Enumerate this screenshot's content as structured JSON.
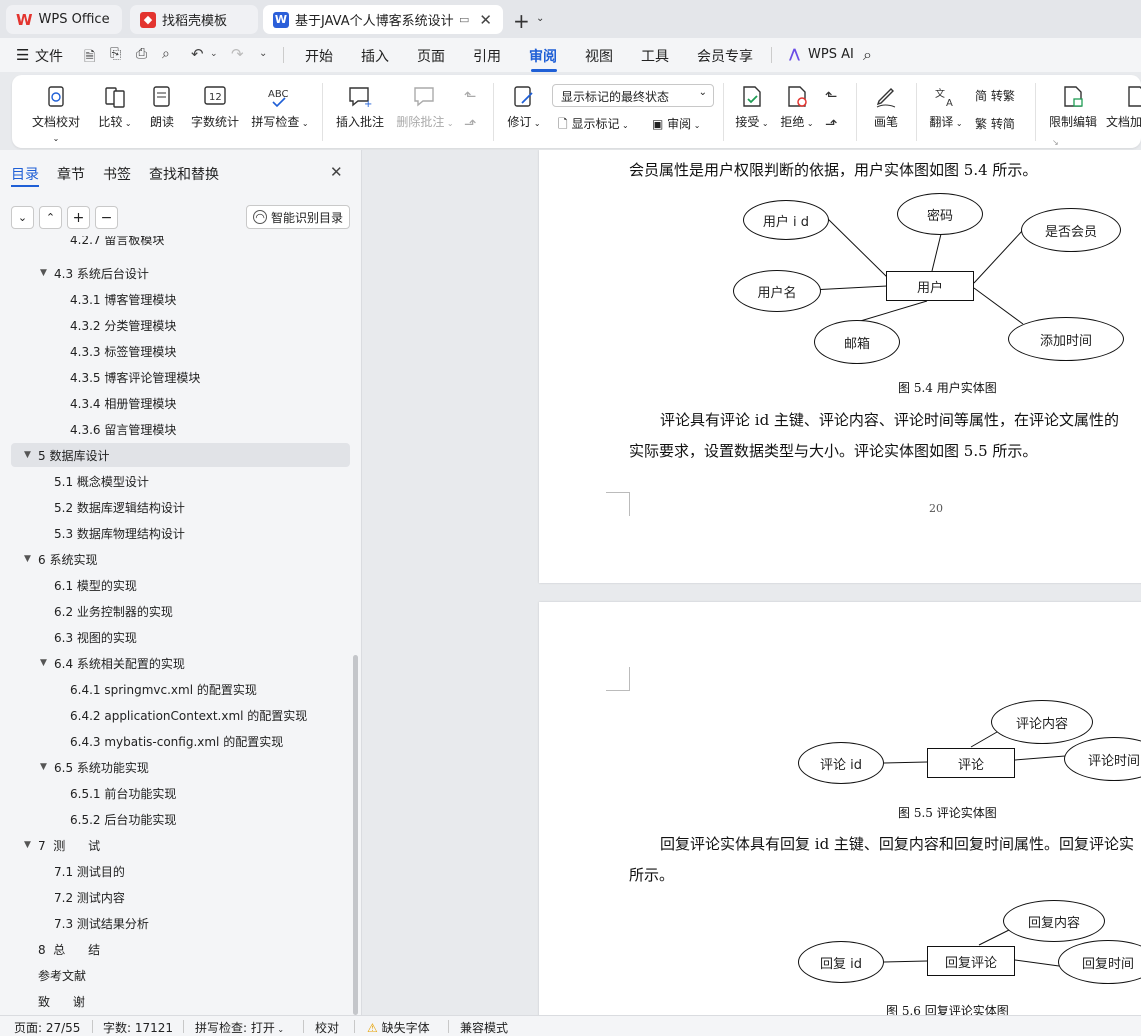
{
  "tabs": [
    {
      "label": "WPS Office",
      "icon": "wps-logo-icon"
    },
    {
      "label": "找稻壳模板",
      "icon": "docer-icon"
    },
    {
      "label": "基于JAVA个人博客系统设计 与",
      "icon": "word-doc-icon",
      "active": true
    }
  ],
  "menu": {
    "file": "文件",
    "items": [
      "开始",
      "插入",
      "页面",
      "引用",
      "审阅",
      "视图",
      "工具",
      "会员专享"
    ],
    "active": "审阅",
    "wps_ai": "WPS AI"
  },
  "ribbon": {
    "doc_check": "文档校对",
    "compare": "比较",
    "read_aloud": "朗读",
    "word_count": "字数统计",
    "spell_check": "拼写检查",
    "insert_comment": "插入批注",
    "delete_comment": "删除批注",
    "revise": "修订",
    "markup_state": "显示标记的最终状态",
    "show_markup": "显示标记",
    "review": "审阅",
    "accept": "接受",
    "reject": "拒绝",
    "pen": "画笔",
    "translate": "翻译",
    "to_traditional": "转繁",
    "to_simplified": "转简",
    "restrict_edit": "限制编辑",
    "doc_encrypt": "文档加"
  },
  "sidebar": {
    "tabs": [
      "目录",
      "章节",
      "书签",
      "查找和替换"
    ],
    "smart_toc": "智能识别目录",
    "toc": [
      {
        "label": "4.2.7  留言板模块",
        "level": 3
      },
      {
        "label": "4.3  系统后台设计",
        "level": 2,
        "expanded": true
      },
      {
        "label": "4.3.1  博客管理模块",
        "level": 3
      },
      {
        "label": "4.3.2  分类管理模块",
        "level": 3
      },
      {
        "label": "4.3.3  标签管理模块",
        "level": 3
      },
      {
        "label": "4.3.5  博客评论管理模块",
        "level": 3
      },
      {
        "label": "4.3.4  相册管理模块",
        "level": 3
      },
      {
        "label": "4.3.6  留言管理模块",
        "level": 3
      },
      {
        "label": "5  数据库设计",
        "level": 1,
        "expanded": true,
        "selected": true
      },
      {
        "label": "5.1  概念模型设计",
        "level": 2
      },
      {
        "label": "5.2  数据库逻辑结构设计",
        "level": 2
      },
      {
        "label": "5.3  数据库物理结构设计",
        "level": 2
      },
      {
        "label": "6  系统实现",
        "level": 1,
        "expanded": true
      },
      {
        "label": "6.1  模型的实现",
        "level": 2
      },
      {
        "label": "6.2  业务控制器的实现",
        "level": 2
      },
      {
        "label": "6.3  视图的实现",
        "level": 2
      },
      {
        "label": "6.4  系统相关配置的实现",
        "level": 2,
        "expanded": true
      },
      {
        "label": "6.4.1 springmvc.xml 的配置实现",
        "level": 3
      },
      {
        "label": "6.4.2 applicationContext.xml 的配置实现",
        "level": 3
      },
      {
        "label": "6.4.3 mybatis-config.xml 的配置实现",
        "level": 3
      },
      {
        "label": "6.5  系统功能实现",
        "level": 2,
        "expanded": true
      },
      {
        "label": "6.5.1  前台功能实现",
        "level": 3
      },
      {
        "label": "6.5.2  后台功能实现",
        "level": 3
      },
      {
        "label": "7  测      试",
        "level": 1,
        "expanded": true
      },
      {
        "label": "7.1  测试目的",
        "level": 2
      },
      {
        "label": "7.2  测试内容",
        "level": 2
      },
      {
        "label": "7.3  测试结果分析",
        "level": 2
      },
      {
        "label": "8  总      结",
        "level": 1
      },
      {
        "label": "参考文献",
        "level": 1
      },
      {
        "label": "致      谢",
        "level": 1
      }
    ]
  },
  "document": {
    "page1": {
      "line1": "会员属性是用户权限判断的依据，用户实体图如图 5.4 所示。",
      "fig54": {
        "entity": "用户",
        "attrs": [
          "用户 i d",
          "密码",
          "是否会员",
          "用户名",
          "邮箱",
          "添加时间"
        ],
        "caption": "图 5.4  用户实体图"
      },
      "para2_line1": "评论具有评论 id 主键、评论内容、评论时间等属性，在评论文属性的",
      "para2_line2": "实际要求，设置数据类型与大小。评论实体图如图 5.5 所示。",
      "page_number": "20"
    },
    "page2": {
      "fig55": {
        "entity": "评论",
        "attrs": [
          "评论 id",
          "评论内容",
          "评论时间"
        ],
        "caption": "图 5.5  评论实体图"
      },
      "para3_line1": "回复评论实体具有回复 id 主键、回复内容和回复时间属性。回复评论实",
      "para3_line2": "所示。",
      "fig56": {
        "entity": "回复评论",
        "attrs": [
          "回复 id",
          "回复内容",
          "回复时间"
        ],
        "caption": "图 5.6  回复评论实体图"
      }
    }
  },
  "status": {
    "page": "页面: 27/55",
    "words": "字数: 17121",
    "spell": "拼写检查: 打开",
    "proof": "校对",
    "missing_font": "缺失字体",
    "compat": "兼容模式"
  },
  "colors": {
    "accent": "#1f5fd6",
    "wps_red": "#e3342f",
    "word_blue": "#2b5fd9"
  }
}
